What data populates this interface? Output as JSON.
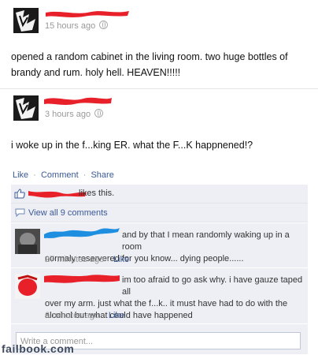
{
  "post1": {
    "timestamp": "15 hours ago",
    "message_line1": "opened a random cabinet in the living room. two huge bottles of",
    "message_line2": "brandy and rum. holy hell. HEAVEN!!!!!"
  },
  "post2": {
    "timestamp": "3 hours ago",
    "message": "i woke up in the f...king ER. what the F...K happnened!?"
  },
  "actions": {
    "like": "Like",
    "comment": "Comment",
    "share": "Share",
    "sep": "·"
  },
  "likes": {
    "text": "likes this."
  },
  "view_all": "View all 9 comments",
  "comments": [
    {
      "line1": "and by that I mean randomly waking up in a room",
      "line2": "normaly reservered for you know... dying people......",
      "time": "27 minutes ago",
      "like": "Like"
    },
    {
      "line1": "im too afraid to go ask why. i have gauze taped all",
      "line2": "over my arm. just what the f...k.. it must have had to do with the",
      "line3": "alcohol but what could have happened",
      "time": "6 minutes ago",
      "like": "Like"
    }
  ],
  "write_comment": {
    "placeholder": "Write a comment..."
  },
  "watermark": "failbook.com",
  "colors": {
    "link": "#3b5998",
    "redact_red": "#e8202a",
    "redact_blue": "#1e8fe0",
    "box_bg": "#edeff4"
  }
}
